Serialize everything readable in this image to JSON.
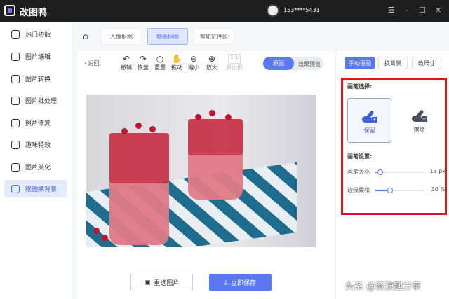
{
  "app": {
    "title": "改图鸭",
    "user_phone": "153****5431"
  },
  "sidebar": {
    "items": [
      {
        "label": "热门功能"
      },
      {
        "label": "图片编辑"
      },
      {
        "label": "图片转换"
      },
      {
        "label": "图片批处理"
      },
      {
        "label": "照片修复"
      },
      {
        "label": "趣味特效"
      },
      {
        "label": "图片美化"
      },
      {
        "label": "抠图换背景",
        "active": true
      }
    ]
  },
  "tabs": [
    {
      "label": "人像抠图"
    },
    {
      "label": "物品抠图",
      "active": true
    },
    {
      "label": "智能证件照"
    }
  ],
  "toolbar": {
    "back": "返回",
    "tools": [
      {
        "label": "撤销",
        "icon": "↶"
      },
      {
        "label": "恢复",
        "icon": "↷"
      },
      {
        "label": "重置",
        "icon": "○"
      },
      {
        "label": "拖动",
        "icon": "✋"
      },
      {
        "label": "缩小",
        "icon": "⊖"
      },
      {
        "label": "放大",
        "icon": "⊕"
      },
      {
        "label": "原比例",
        "icon": "1:1"
      }
    ],
    "view_original": "原图",
    "view_preview": "效果预览"
  },
  "buttons": {
    "reselect": "重选图片",
    "save": "立即保存"
  },
  "right_panel": {
    "tabs": [
      "手动抠图",
      "换背景",
      "改尺寸"
    ],
    "brush_select_label": "画笔选择:",
    "brush_keep": "保留",
    "brush_erase": "擦除",
    "brush_settings_label": "画笔设置:",
    "brush_size_label": "画笔大小",
    "brush_size_value": "13 px",
    "brush_size_fraction": 0.1,
    "edge_soft_label": "边缘柔和",
    "edge_soft_value": "30 %",
    "edge_soft_fraction": 0.3
  },
  "watermark": "头条 @资源趣分享",
  "colors": {
    "accent": "#5b78f0",
    "highlight_box": "#e0121b"
  }
}
